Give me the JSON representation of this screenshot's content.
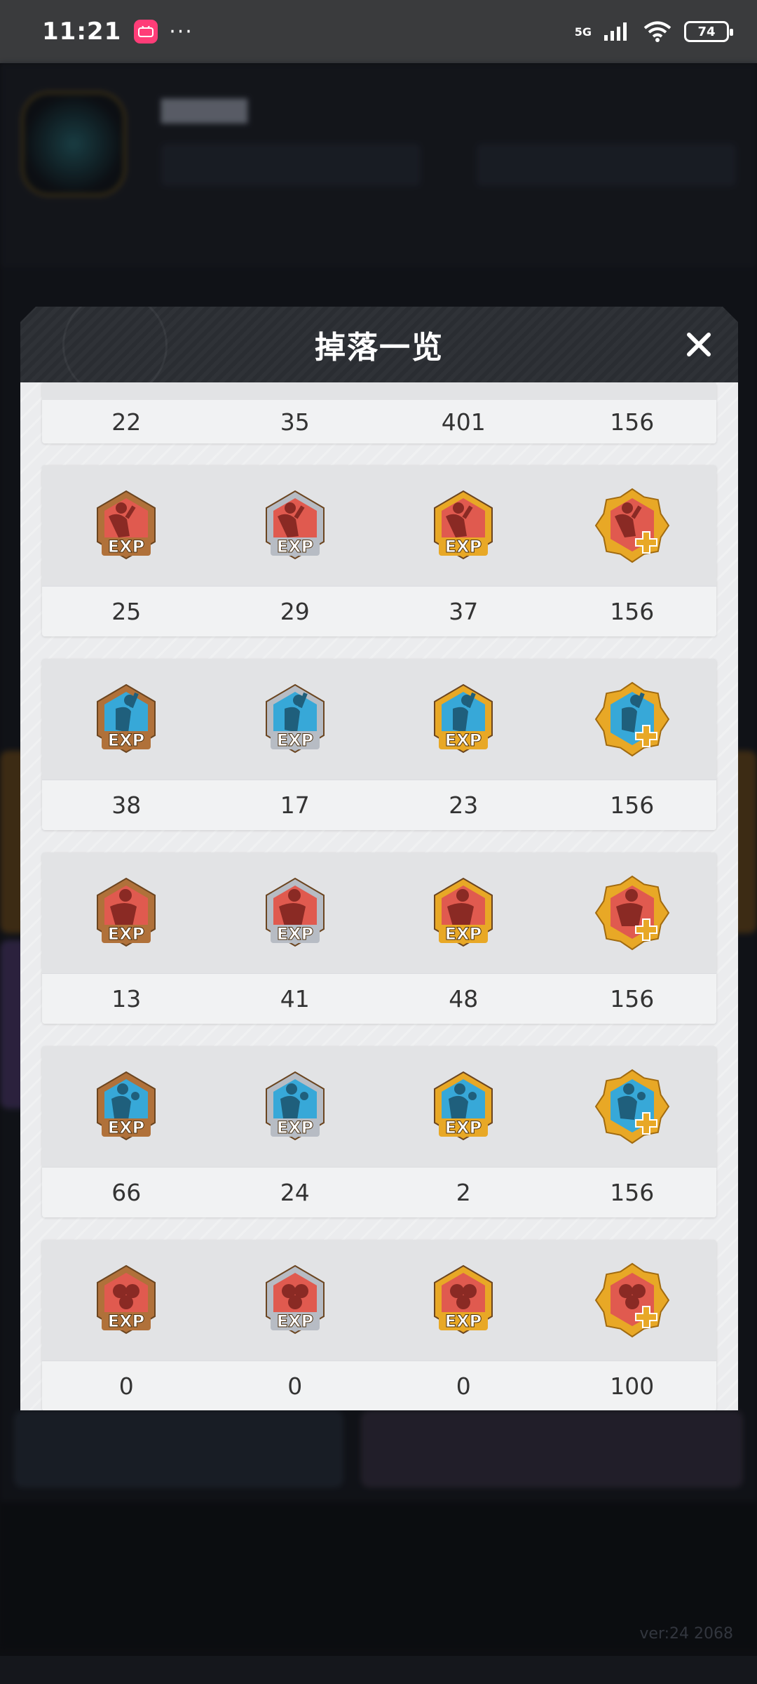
{
  "status_bar": {
    "time": "11:21",
    "app_icon_text": "bilibili",
    "more": "···",
    "network": "5G",
    "battery": "74"
  },
  "dialog": {
    "title": "掉落一览",
    "groups": [
      {
        "type": "partial",
        "values": [
          "22",
          "35",
          "401",
          "156"
        ]
      },
      {
        "color": "red",
        "figure": "shooter",
        "values": [
          "25",
          "29",
          "37",
          "156"
        ]
      },
      {
        "color": "blue",
        "figure": "dunker",
        "values": [
          "38",
          "17",
          "23",
          "156"
        ]
      },
      {
        "color": "red",
        "figure": "defender",
        "values": [
          "13",
          "41",
          "48",
          "156"
        ]
      },
      {
        "color": "blue",
        "figure": "passer",
        "values": [
          "66",
          "24",
          "2",
          "156"
        ]
      },
      {
        "color": "red",
        "figure": "balls",
        "values": [
          "0",
          "0",
          "0",
          "100"
        ]
      }
    ],
    "badge_types": [
      {
        "frame": "bronze",
        "mark": "EXP"
      },
      {
        "frame": "silver",
        "mark": "EXP"
      },
      {
        "frame": "gold",
        "mark": "EXP"
      },
      {
        "frame": "gold-star",
        "mark": "+"
      }
    ]
  },
  "background": {
    "version_text": "ver:24  2068"
  },
  "colors": {
    "red_badge": "#e05a4f",
    "blue_badge": "#37a8d8",
    "bronze": "#b0713a",
    "silver": "#b7bcc4",
    "gold": "#e8a826"
  }
}
